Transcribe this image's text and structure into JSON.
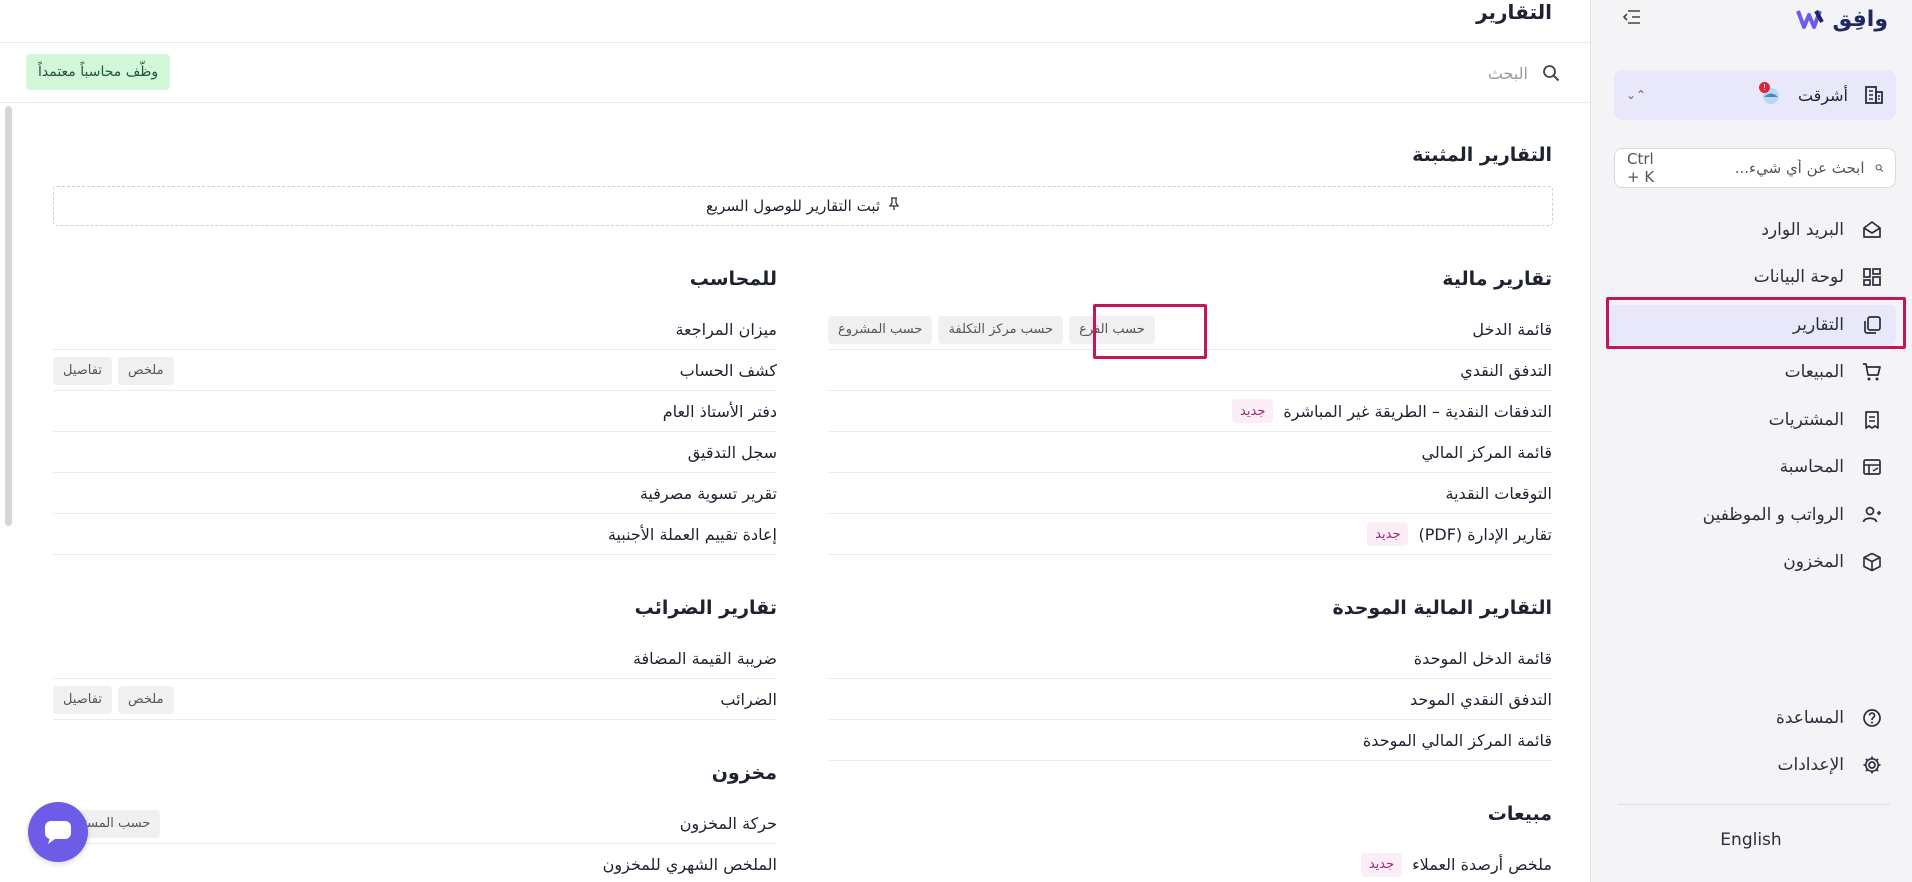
{
  "sidebar": {
    "brand": "وافِق",
    "company": "أشرقت",
    "notification_count": "!",
    "search": {
      "placeholder": "ابحث عن أي شيء...",
      "shortcut": "Ctrl + K"
    },
    "items": [
      {
        "label": "البريد الوارد",
        "icon": "inbox-icon"
      },
      {
        "label": "لوحة البيانات",
        "icon": "dashboard-icon"
      },
      {
        "label": "التقارير",
        "icon": "reports-icon",
        "active": true
      },
      {
        "label": "المبيعات",
        "icon": "cart-icon"
      },
      {
        "label": "المشتريات",
        "icon": "receipt-icon"
      },
      {
        "label": "المحاسبة",
        "icon": "ledger-icon"
      },
      {
        "label": "الرواتب و الموظفين",
        "icon": "users-icon"
      },
      {
        "label": "المخزون",
        "icon": "box-icon"
      }
    ],
    "bottom_items": [
      {
        "label": "المساعدة",
        "icon": "help-icon"
      },
      {
        "label": "الإعدادات",
        "icon": "gear-icon"
      }
    ],
    "language": "English"
  },
  "header": {
    "title": "التقارير",
    "search_placeholder": "البحث",
    "hire_button": "وظّف محاسباً معتمداً"
  },
  "pinned": {
    "title": "التقارير المثبتة",
    "hint": "ثبت التقارير للوصول السريع"
  },
  "financial": {
    "title": "تقارير مالية",
    "rows": [
      {
        "label": "قائمة الدخل",
        "tags": [
          "حسب المشروع",
          "حسب مركز التكلفة",
          "حسب الفرع"
        ]
      },
      {
        "label": "التدفق النقدي"
      },
      {
        "label": "التدفقات النقدية – الطريقة غير المباشرة",
        "badge": "جديد"
      },
      {
        "label": "قائمة المركز المالي"
      },
      {
        "label": "التوقعات النقدية"
      },
      {
        "label": "تقارير الإدارة (PDF)",
        "badge": "جديد"
      }
    ]
  },
  "accountant": {
    "title": "للمحاسب",
    "rows": [
      {
        "label": "ميزان المراجعة"
      },
      {
        "label": "كشف الحساب",
        "tags": [
          "تفاصيل",
          "ملخص"
        ]
      },
      {
        "label": "دفتر الأستاذ العام"
      },
      {
        "label": "سجل التدقيق"
      },
      {
        "label": "تقرير تسوية مصرفية"
      },
      {
        "label": "إعادة تقييم العملة الأجنبية"
      }
    ]
  },
  "consolidated": {
    "title": "التقارير المالية الموحدة",
    "rows": [
      {
        "label": "قائمة الدخل الموحدة"
      },
      {
        "label": "التدفق النقدي الموحد"
      },
      {
        "label": "قائمة المركز المالي الموحدة"
      }
    ]
  },
  "taxes": {
    "title": "تقارير الضرائب",
    "rows": [
      {
        "label": "ضريبة القيمة المضافة"
      },
      {
        "label": "الضرائب",
        "tags": [
          "تفاصيل",
          "ملخص"
        ]
      }
    ]
  },
  "inventory": {
    "title": "مخزون",
    "rows": [
      {
        "label": "حركة المخزون",
        "tags": [
          "حسب المستودع"
        ]
      },
      {
        "label": "الملخص الشهري للمخزون"
      }
    ]
  },
  "sales": {
    "title": "مبيعات",
    "rows": [
      {
        "label": "ملخص أرصدة العملاء",
        "badge": "جديد"
      }
    ]
  },
  "colors": {
    "accent": "#6c5ce7",
    "active_bg": "#e9e8fa",
    "highlight": "#c2185b",
    "hire_bg": "#d4f7dc"
  }
}
